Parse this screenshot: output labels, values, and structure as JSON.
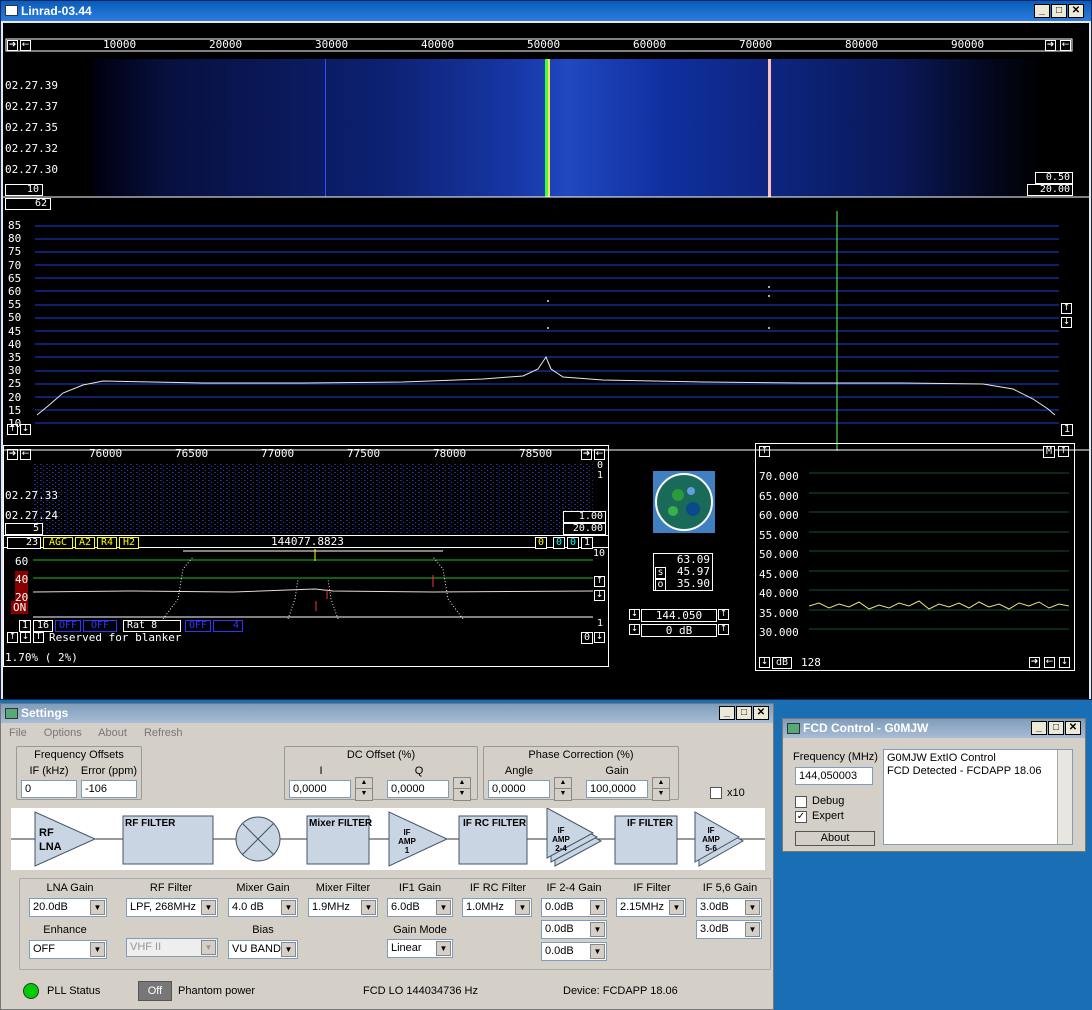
{
  "linrad": {
    "title": "Linrad-03.44",
    "wf_ticks": [
      "10000",
      "20000",
      "30000",
      "40000",
      "50000",
      "60000",
      "70000",
      "80000",
      "90000"
    ],
    "wf_times": [
      "02.27.39",
      "02.27.37",
      "02.27.35",
      "02.27.32",
      "02.27.30"
    ],
    "wf_left_box": "10",
    "wf_right_top": "0.50",
    "wf_right_bottom": "20.00",
    "spec_top_box": "62",
    "spec_levels": [
      "85",
      "80",
      "75",
      "70",
      "65",
      "60",
      "55",
      "50",
      "45",
      "40",
      "35",
      "30",
      "25",
      "20",
      "15",
      "10"
    ],
    "bl_ticks": [
      "76000",
      "76500",
      "77000",
      "77500",
      "78000",
      "78500"
    ],
    "bl_times": [
      "02.27.33",
      "02.27.24"
    ],
    "bl_box_left": "5",
    "bl_right_top": "1.00",
    "bl_right_bottom": "20.00",
    "bl_right_a": "0",
    "bl_right_b": "1",
    "bl_status_num": "23",
    "bl_agc": [
      "AGC",
      "A2",
      "R4",
      "H2"
    ],
    "bl_freq": "144077.8823",
    "bl_right_nums": [
      "0",
      "0",
      "0",
      "1"
    ],
    "bl_10": "10",
    "bl_levels": [
      "60",
      "40",
      "20"
    ],
    "bl_on": "ON",
    "bl_one": "1",
    "bl_row3": [
      "1",
      "16",
      "OFF",
      "OFF",
      "Rat  8",
      "OFF",
      "4"
    ],
    "bl_reserved": "Reserved for blanker",
    "bl_zero": "0",
    "pct": "1.70%  ( 2%)",
    "meter": [
      "63.09",
      "45.97",
      "35.90"
    ],
    "meter_labels": [
      "s",
      "o"
    ],
    "freq_box": "144.050",
    "db_box": "0 dB",
    "graph_levels": [
      "70.000",
      "65.000",
      "60.000",
      "55.000",
      "50.000",
      "45.000",
      "40.000",
      "35.000",
      "30.000"
    ],
    "graph_m": "M",
    "graph_db": "dB",
    "graph_128": "128"
  },
  "settings": {
    "title": "Settings",
    "menu": [
      "File",
      "Options",
      "About",
      "Refresh"
    ],
    "freq_offsets": {
      "title": "Frequency Offsets",
      "if_label": "IF (kHz)",
      "if_value": "0",
      "err_label": "Error (ppm)",
      "err_value": "-106"
    },
    "dc_offset": {
      "title": "DC Offset (%)",
      "i_label": "I",
      "i_value": "0,0000",
      "q_label": "Q",
      "q_value": "0,0000"
    },
    "phase": {
      "title": "Phase Correction (%)",
      "angle_label": "Angle",
      "angle_value": "0,0000",
      "gain_label": "Gain",
      "gain_value": "100,0000"
    },
    "x10": "x10",
    "blocks": [
      "RF LNA",
      "RF FILTER",
      "Mixer FILTER",
      "IF AMP 1",
      "IF RC FILTER",
      "IF AMP 2-4",
      "IF FILTER",
      "IF AMP 5-6"
    ],
    "controls": {
      "lna_gain": "LNA Gain",
      "lna_gain_val": "20.0dB",
      "enhance": "Enhance",
      "enhance_val": "OFF",
      "rf_filter": "RF Filter",
      "rf_filter_val": "LPF, 268MHz",
      "rf_band_val": "VHF II",
      "mixer_gain": "Mixer Gain",
      "mixer_gain_val": "4.0 dB",
      "bias": "Bias",
      "bias_val": "VU BAND",
      "mixer_filter": "Mixer Filter",
      "mixer_filter_val": "1.9MHz",
      "if1_gain": "IF1 Gain",
      "if1_gain_val": "6.0dB",
      "gain_mode": "Gain Mode",
      "gain_mode_val": "Linear",
      "if_rc_filter": "IF RC Filter",
      "if_rc_filter_val": "1.0MHz",
      "if24_gain": "IF 2-4  Gain",
      "if24_vals": [
        "0.0dB",
        "0.0dB",
        "0.0dB"
      ],
      "if_filter": "IF Filter",
      "if_filter_val": "2.15MHz",
      "if56_gain": "IF 5,6  Gain",
      "if56_vals": [
        "3.0dB",
        "3.0dB"
      ]
    },
    "status": {
      "pll": "PLL Status",
      "pll_color": "#00cc00",
      "off_btn": "Off",
      "phantom": "Phantom power",
      "fcd_lo": "FCD LO 144034736 Hz",
      "device": "Device: FCDAPP 18.06"
    }
  },
  "fcd": {
    "title": "FCD Control - G0MJW",
    "freq_label": "Frequency (MHz)",
    "freq_value": "144,050003",
    "debug": "Debug",
    "expert": "Expert",
    "about": "About",
    "log": [
      "G0MJW ExtIO Control",
      "FCD Detected - FCDAPP 18.06"
    ]
  }
}
